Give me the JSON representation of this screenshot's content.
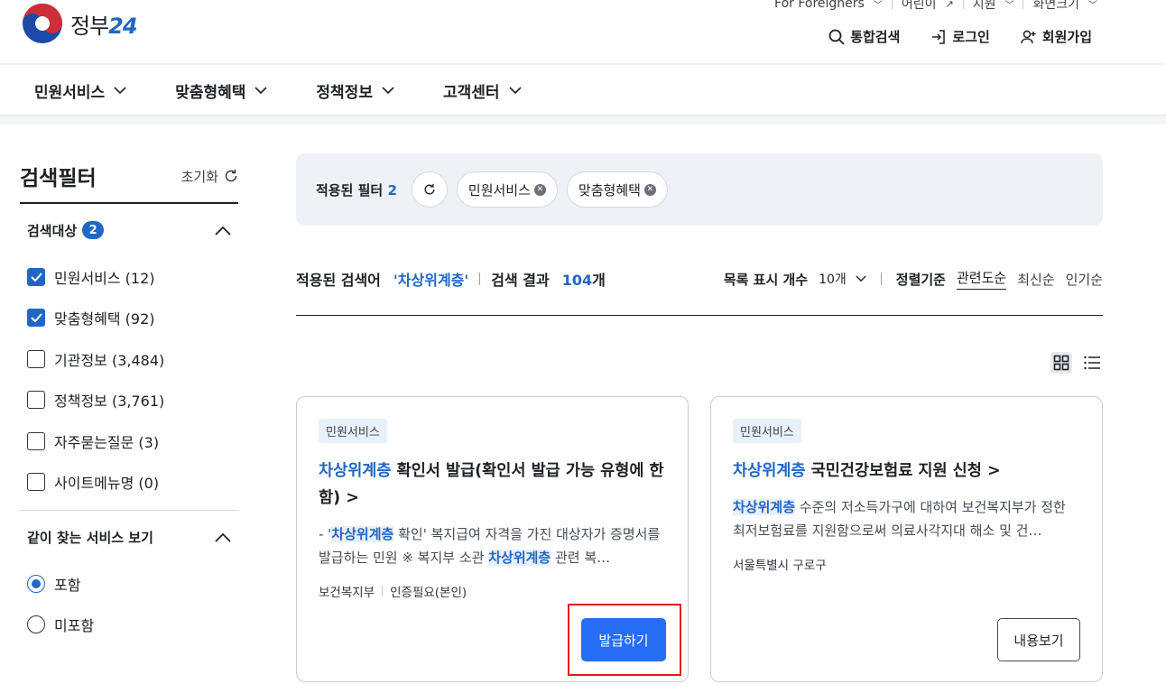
{
  "header": {
    "logo_text": "정부",
    "logo_num": "24",
    "utility": [
      {
        "label": "For Foreigners"
      },
      {
        "label": "어린이"
      },
      {
        "label": "지원"
      },
      {
        "label": "화면크기"
      }
    ],
    "actions": {
      "search": "통합검색",
      "login": "로그인",
      "signup": "회원가입"
    }
  },
  "gnb": [
    "민원서비스",
    "맞춤형혜택",
    "정책정보",
    "고객센터"
  ],
  "sidebar": {
    "title": "검색필터",
    "reset": "초기화",
    "target_section": {
      "title": "검색대상",
      "badge": "2",
      "items": [
        {
          "label": "민원서비스 (12)",
          "checked": true
        },
        {
          "label": "맞춤형혜택 (92)",
          "checked": true
        },
        {
          "label": "기관정보 (3,484)",
          "checked": false
        },
        {
          "label": "정책정보 (3,761)",
          "checked": false
        },
        {
          "label": "자주묻는질문 (3)",
          "checked": false
        },
        {
          "label": "사이트메뉴명 (0)",
          "checked": false
        }
      ]
    },
    "similar_section": {
      "title": "같이 찾는 서비스 보기",
      "options": [
        {
          "label": "포함",
          "selected": true
        },
        {
          "label": "미포함",
          "selected": false
        }
      ]
    }
  },
  "filterbar": {
    "label": "적용된 필터",
    "count": "2",
    "chips": [
      "민원서비스",
      "맞춤형혜택"
    ]
  },
  "results": {
    "keyword_label": "적용된 검색어",
    "keyword": "'차상위계층'",
    "result_label": "검색 결과",
    "count": "104",
    "count_unit": "개",
    "page_size_label": "목록 표시 개수",
    "page_size": "10개",
    "sort_label": "정렬기준",
    "sort_options": [
      "관련도순",
      "최신순",
      "인기순"
    ]
  },
  "cards": [
    {
      "tag": "민원서비스",
      "title_hl": "차상위계층",
      "title_rest": " 확인서 발급(확인서 발급 가능 유형에 한함) >",
      "desc_1": "- '",
      "desc_hl_1": "차상위계층",
      "desc_2": " 확인' 복지급여 자격을 가진 대상자가 증명서를 발급하는 민원 ※ 복지부 소관 ",
      "desc_hl_2": "차상위계층",
      "desc_3": " 관련 복…",
      "meta_1": "보건복지부",
      "meta_2": "인증필요(본인)",
      "button": "발급하기"
    },
    {
      "tag": "민원서비스",
      "title_hl": "차상위계층",
      "title_rest": " 국민건강보험료 지원 신청 >",
      "desc_hl_1": "차상위계층",
      "desc_2": " 수준의 저소득가구에 대하여 보건복지부가 정한 최저보험료를 지원함으로써 의료사각지대 해소 및 건…",
      "meta_1": "서울특별시 구로구",
      "button": "내용보기"
    }
  ],
  "colors": {
    "accent": "#2266c4",
    "button": "#256ef4",
    "highlight_border": "#e01e1e"
  }
}
